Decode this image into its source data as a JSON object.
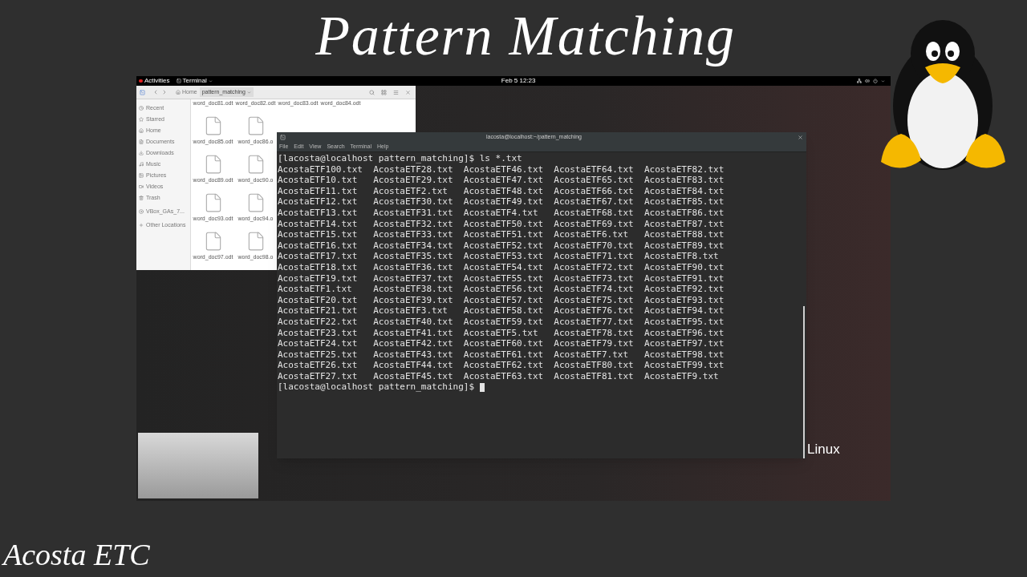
{
  "video_title": "Pattern Matching",
  "top_bar": {
    "activities": "Activities",
    "app_menu": "Terminal",
    "clock": "Feb 5 12:23"
  },
  "file_manager": {
    "path": [
      {
        "label": "Home",
        "selected": false
      },
      {
        "label": "pattern_matching",
        "selected": true
      }
    ],
    "sidebar": [
      {
        "label": "Recent"
      },
      {
        "label": "Starred"
      },
      {
        "label": "Home"
      },
      {
        "label": "Documents"
      },
      {
        "label": "Downloads"
      },
      {
        "label": "Music"
      },
      {
        "label": "Pictures"
      },
      {
        "label": "Videos"
      },
      {
        "label": "Trash"
      },
      {
        "label": "VBox_GAs_7..."
      },
      {
        "label": "Other Locations"
      }
    ],
    "files": [
      {
        "label": "word_doc81.odt"
      },
      {
        "label": "word_doc82.odt"
      },
      {
        "label": "word_doc83.odt"
      },
      {
        "label": "word_doc84.odt"
      },
      {
        "label": "word_doc85.odt"
      },
      {
        "label": "word_doc86.o"
      },
      {
        "label": "word_doc89.odt"
      },
      {
        "label": "word_doc90.o"
      },
      {
        "label": "word_doc93.odt"
      },
      {
        "label": "word_doc94.o"
      },
      {
        "label": "word_doc97.odt"
      },
      {
        "label": "word_doc98.o"
      }
    ]
  },
  "terminal": {
    "title": "lacosta@localhost:~/pattern_matching",
    "menu": [
      "File",
      "Edit",
      "View",
      "Search",
      "Terminal",
      "Help"
    ],
    "command_line": "[lacosta@localhost pattern_matching]$ ls *.txt",
    "lines": [
      "AcostaETF100.txt  AcostaETF28.txt  AcostaETF46.txt  AcostaETF64.txt  AcostaETF82.txt",
      "AcostaETF10.txt   AcostaETF29.txt  AcostaETF47.txt  AcostaETF65.txt  AcostaETF83.txt",
      "AcostaETF11.txt   AcostaETF2.txt   AcostaETF48.txt  AcostaETF66.txt  AcostaETF84.txt",
      "AcostaETF12.txt   AcostaETF30.txt  AcostaETF49.txt  AcostaETF67.txt  AcostaETF85.txt",
      "AcostaETF13.txt   AcostaETF31.txt  AcostaETF4.txt   AcostaETF68.txt  AcostaETF86.txt",
      "AcostaETF14.txt   AcostaETF32.txt  AcostaETF50.txt  AcostaETF69.txt  AcostaETF87.txt",
      "AcostaETF15.txt   AcostaETF33.txt  AcostaETF51.txt  AcostaETF6.txt   AcostaETF88.txt",
      "AcostaETF16.txt   AcostaETF34.txt  AcostaETF52.txt  AcostaETF70.txt  AcostaETF89.txt",
      "AcostaETF17.txt   AcostaETF35.txt  AcostaETF53.txt  AcostaETF71.txt  AcostaETF8.txt",
      "AcostaETF18.txt   AcostaETF36.txt  AcostaETF54.txt  AcostaETF72.txt  AcostaETF90.txt",
      "AcostaETF19.txt   AcostaETF37.txt  AcostaETF55.txt  AcostaETF73.txt  AcostaETF91.txt",
      "AcostaETF1.txt    AcostaETF38.txt  AcostaETF56.txt  AcostaETF74.txt  AcostaETF92.txt",
      "AcostaETF20.txt   AcostaETF39.txt  AcostaETF57.txt  AcostaETF75.txt  AcostaETF93.txt",
      "AcostaETF21.txt   AcostaETF3.txt   AcostaETF58.txt  AcostaETF76.txt  AcostaETF94.txt",
      "AcostaETF22.txt   AcostaETF40.txt  AcostaETF59.txt  AcostaETF77.txt  AcostaETF95.txt",
      "AcostaETF23.txt   AcostaETF41.txt  AcostaETF5.txt   AcostaETF78.txt  AcostaETF96.txt",
      "AcostaETF24.txt   AcostaETF42.txt  AcostaETF60.txt  AcostaETF79.txt  AcostaETF97.txt",
      "AcostaETF25.txt   AcostaETF43.txt  AcostaETF61.txt  AcostaETF7.txt   AcostaETF98.txt",
      "AcostaETF26.txt   AcostaETF44.txt  AcostaETF62.txt  AcostaETF80.txt  AcostaETF99.txt",
      "AcostaETF27.txt   AcostaETF45.txt  AcostaETF63.txt  AcostaETF81.txt  AcostaETF9.txt"
    ],
    "prompt": "[lacosta@localhost pattern_matching]$"
  },
  "overlay_label": "Linux",
  "channel_logo": "Acosta ETC"
}
